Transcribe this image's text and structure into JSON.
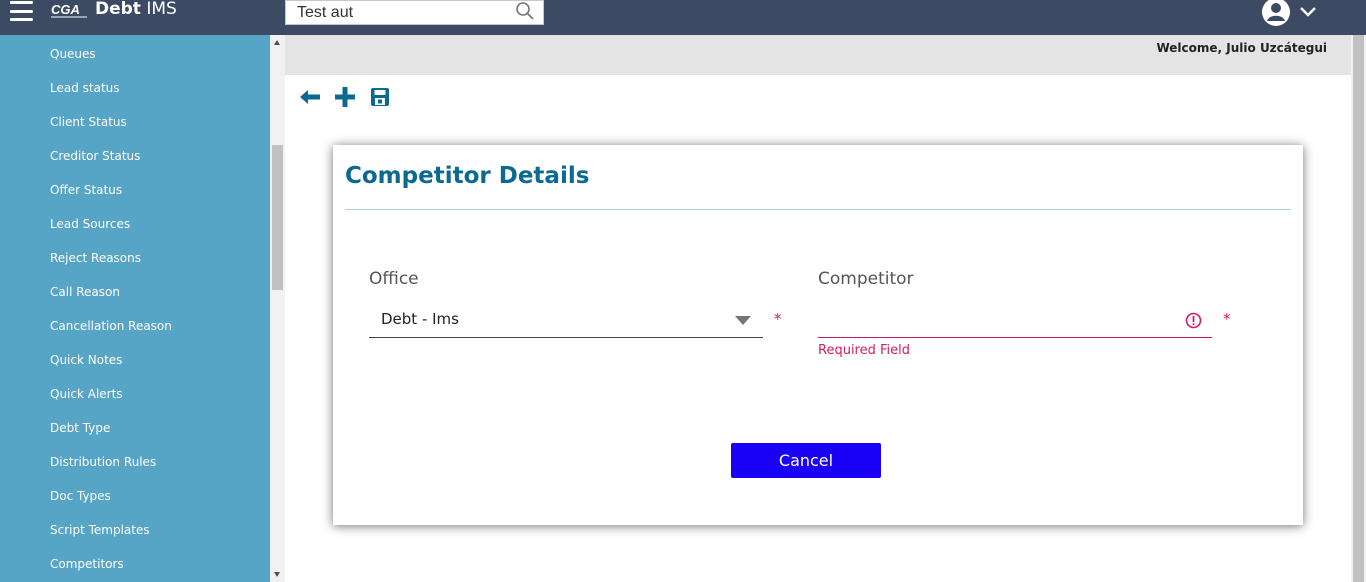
{
  "header": {
    "logo_text": "CGA",
    "app_title_bold": "Debt",
    "app_title_rest": " IMS",
    "search": {
      "value": "Test aut"
    },
    "colors": {
      "bar": "#3c4a63"
    }
  },
  "sidebar": {
    "color": "#57a5c6",
    "items": [
      {
        "label": "Queues"
      },
      {
        "label": "Lead status"
      },
      {
        "label": "Client Status"
      },
      {
        "label": "Creditor Status"
      },
      {
        "label": "Offer Status"
      },
      {
        "label": "Lead Sources"
      },
      {
        "label": "Reject Reasons"
      },
      {
        "label": "Call Reason"
      },
      {
        "label": "Cancellation Reason"
      },
      {
        "label": "Quick Notes"
      },
      {
        "label": "Quick Alerts"
      },
      {
        "label": "Debt Type"
      },
      {
        "label": "Distribution Rules"
      },
      {
        "label": "Doc Types"
      },
      {
        "label": "Script Templates"
      },
      {
        "label": "Competitors"
      }
    ]
  },
  "welcome": {
    "text": "Welcome, Julio Uzcátegui"
  },
  "toolbar": {
    "icons": [
      "back-arrow-icon",
      "add-icon",
      "save-icon"
    ]
  },
  "card": {
    "title": "Competitor Details",
    "office": {
      "label": "Office",
      "value": "Debt - Ims",
      "required": "*"
    },
    "competitor": {
      "label": "Competitor",
      "value": "",
      "required": "*",
      "error": "Required Field"
    },
    "cancel_label": "Cancel",
    "colors": {
      "title": "#0b6a92",
      "error": "#d81b60",
      "button": "#1a00f5"
    }
  }
}
